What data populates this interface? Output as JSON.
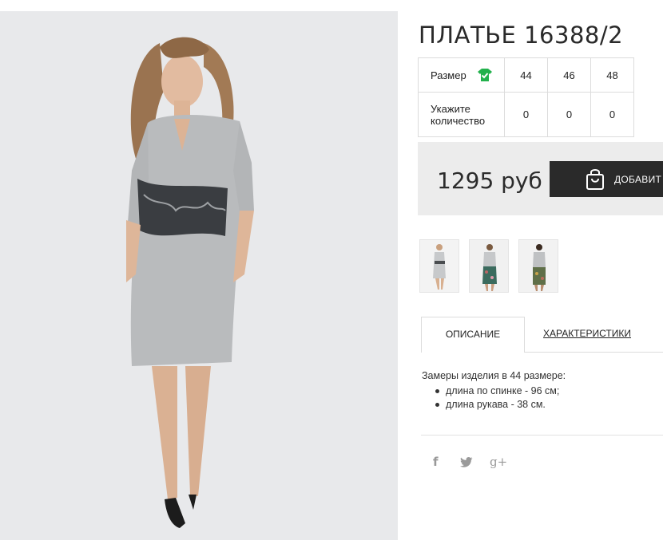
{
  "product": {
    "title": "ПЛАТЬЕ 16388/2"
  },
  "size_table": {
    "size_label": "Размер",
    "size_icon": "green-shirt-check-icon",
    "sizes": [
      "44",
      "46",
      "48"
    ],
    "quantity_label_line1": "Укажите",
    "quantity_label_line2": "количество",
    "quantities": [
      "0",
      "0",
      "0"
    ]
  },
  "purchase": {
    "price": "1295 руб",
    "add_label": "ДОБАВИТ",
    "button_icon": "shopping-bag-icon"
  },
  "tabs": {
    "active": "ОПИСАНИЕ",
    "inactive": "ХАРАКТЕРИСТИКИ"
  },
  "description": {
    "intro": "Замеры изделия в 44 размере:",
    "items": [
      "длина по спинке - 96 см;",
      "длина рукава - 38 см."
    ]
  },
  "social": {
    "facebook": "f",
    "twitter": "twitter-icon",
    "google_plus": "g+"
  },
  "colors": {
    "accent_green": "#22b14c",
    "button_dark": "#2a2a2a",
    "price_bg": "#ececec"
  }
}
